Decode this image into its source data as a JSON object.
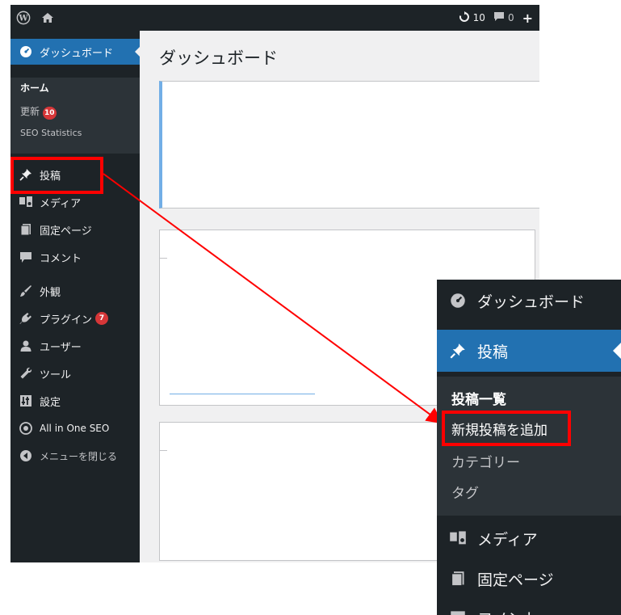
{
  "admin_bar": {
    "updates_count": "10",
    "comments_count": "0",
    "new_label": "+"
  },
  "sidebar": {
    "dashboard": "ダッシュボード",
    "home": "ホーム",
    "updates": "更新",
    "updates_badge": "10",
    "seo_statistics": "SEO Statistics",
    "posts": "投稿",
    "media": "メディア",
    "pages": "固定ページ",
    "comments": "コメント",
    "appearance": "外観",
    "plugins": "プラグイン",
    "plugins_badge": "7",
    "users": "ユーザー",
    "tools": "ツール",
    "settings": "設定",
    "all_in_one_seo": "All in One SEO",
    "collapse": "メニューを閉じる"
  },
  "main": {
    "title": "ダッシュボード"
  },
  "zoom": {
    "dashboard": "ダッシュボード",
    "posts": "投稿",
    "all_posts": "投稿一覧",
    "add_new": "新規投稿を追加",
    "categories": "カテゴリー",
    "tags": "タグ",
    "media": "メディア",
    "pages": "固定ページ",
    "comments": "コメント"
  },
  "colors": {
    "admin_dark": "#1d2327",
    "submenu_bg": "#2c3338",
    "accent_blue": "#2271b1",
    "highlight_red": "#ff0000",
    "badge_red": "#d63638"
  }
}
